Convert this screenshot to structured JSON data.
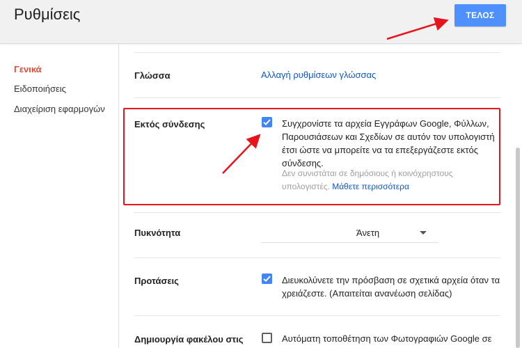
{
  "header": {
    "title": "Ρυθμίσεις",
    "done_label": "ΤΕΛΟΣ"
  },
  "sidebar": {
    "items": [
      {
        "label": "Γενικά",
        "active": true
      },
      {
        "label": "Ειδοποιήσεις",
        "active": false
      },
      {
        "label": "Διαχείριση εφαρμογών",
        "active": false
      }
    ]
  },
  "settings": {
    "language": {
      "label": "Γλώσσα",
      "link": "Αλλαγή ρυθμίσεων γλώσσας"
    },
    "offline": {
      "label": "Εκτός σύνδεσης",
      "checked": true,
      "description": "Συγχρονίστε τα αρχεία Εγγράφων Google, Φύλλων, Παρουσιάσεων και Σχεδίων σε αυτόν τον υπολογιστή έτσι ώστε να μπορείτε να τα επεξεργάζεστε εκτός σύνδεσης.",
      "hint": "Δεν συνιστάται σε δημόσιους ή κοινόχρηστους υπολογιστές.",
      "learn_more": "Μάθετε περισσότερα"
    },
    "density": {
      "label": "Πυκνότητα",
      "value": "Άνετη"
    },
    "suggestions": {
      "label": "Προτάσεις",
      "checked": true,
      "description": "Διευκολύνετε την πρόσβαση σε σχετικά αρχεία όταν τα χρειάζεστε. (Απαιτείται ανανέωση σελίδας)"
    },
    "create_folder": {
      "label": "Δημιουργία φακέλου στις",
      "checked": false,
      "description": "Αυτόματη τοποθέτηση των Φωτογραφιών Google σε"
    }
  },
  "colors": {
    "accent": "#4285f4",
    "button": "#4d90fe",
    "active_nav": "#dd4b39",
    "annotation": "#e8141d",
    "link": "#1155cc"
  }
}
